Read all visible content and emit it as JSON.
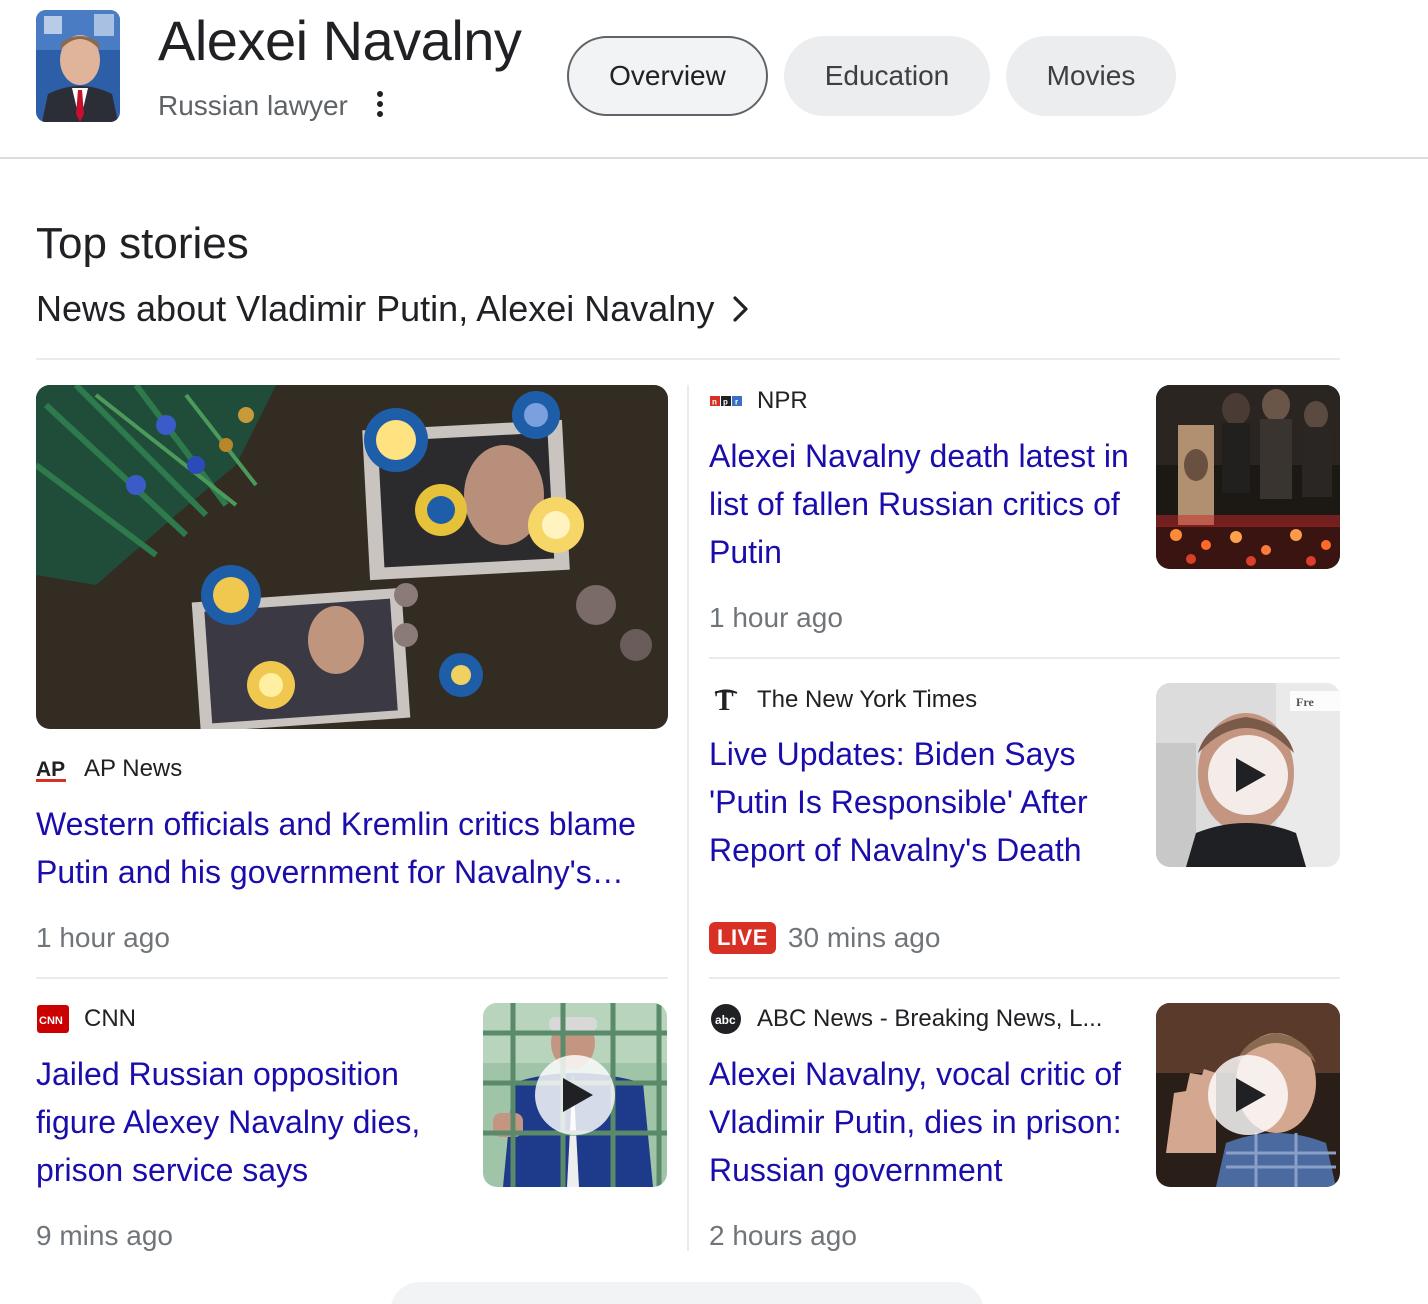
{
  "entity": {
    "name": "Alexei Navalny",
    "description": "Russian lawyer"
  },
  "tabs": [
    {
      "label": "Overview",
      "active": true
    },
    {
      "label": "Education",
      "active": false
    },
    {
      "label": "Movies",
      "active": false
    }
  ],
  "top_stories": {
    "title": "Top stories",
    "link_label": "News about Vladimir Putin, Alexei Navalny",
    "stories": [
      {
        "source": "AP News",
        "logo": "ap-logo",
        "headline": "Western officials and Kremlin critics blame Putin and his government for Navalny's death",
        "time": "1 hour ago",
        "thumbnail": "memorial-photo",
        "has_video": false
      },
      {
        "source": "NPR",
        "logo": "npr-logo",
        "headline": "Alexei Navalny death latest in list of fallen Russian critics of Putin",
        "time": "1 hour ago",
        "thumbnail": "candle-vigil-photo",
        "has_video": false
      },
      {
        "source": "The New York Times",
        "logo": "nyt-logo",
        "headline": "Live Updates: Biden Says 'Putin Is Responsible' After Report of Navalny's Death",
        "badge": "LIVE",
        "time": "30 mins ago",
        "thumbnail": "portrait-video",
        "thumbnail_watermark": "Fre",
        "has_video": true
      },
      {
        "source": "CNN",
        "logo": "cnn-logo",
        "headline": "Jailed Russian opposition figure Alexey Navalny dies, prison service says",
        "time": "9 mins ago",
        "thumbnail": "courtroom-cage-video",
        "has_video": true
      },
      {
        "source": "ABC News - Breaking News, L...",
        "logo": "abc-logo",
        "headline": "Alexei Navalny, vocal critic of Vladimir Putin, dies in prison: Russian government",
        "time": "2 hours ago",
        "thumbnail": "waving-video",
        "has_video": true
      }
    ]
  },
  "colors": {
    "link": "#1a0dab",
    "meta": "#70757a",
    "live": "#d93025",
    "chip_bg": "#ebedef",
    "divider": "#ebebeb"
  }
}
